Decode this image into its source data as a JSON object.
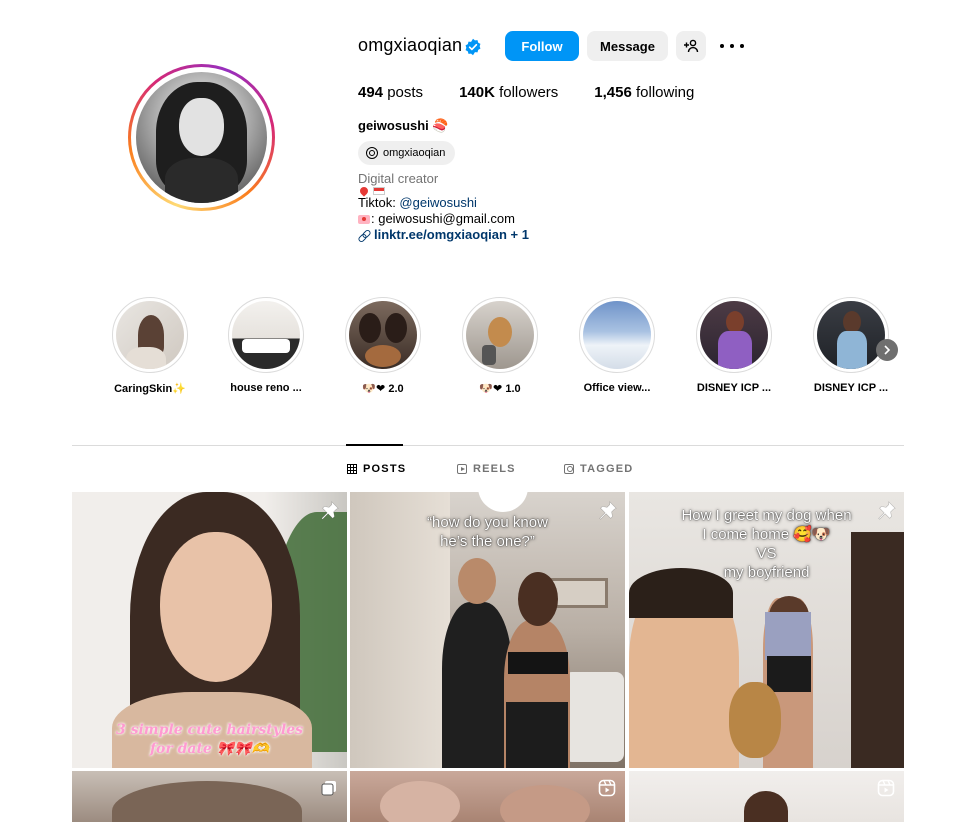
{
  "profile": {
    "username": "omgxiaoqian",
    "verified_icon": "verified-badge-icon",
    "follow_label": "Follow",
    "message_label": "Message",
    "add_user_icon": "add-user-icon",
    "more_icon": "more-options-icon",
    "stats": {
      "posts_count": "494",
      "posts_label": "posts",
      "followers_count": "140K",
      "followers_label": "followers",
      "following_count": "1,456",
      "following_label": "following"
    },
    "display_name": "geiwosushi",
    "display_name_emoji": "🍣",
    "threads_handle": "omgxiaoqian",
    "category": "Digital creator",
    "bio_tiktok_prefix": "Tiktok: ",
    "bio_tiktok_handle": "@geiwosushi",
    "bio_email": ": geiwosushi@gmail.com",
    "bio_link": "linktr.ee/omgxiaoqian + 1"
  },
  "highlights": [
    {
      "label": "CaringSkin✨"
    },
    {
      "label": "house reno ..."
    },
    {
      "label": "🐶❤ 2.0"
    },
    {
      "label": "🐶❤ 1.0"
    },
    {
      "label": "Office view..."
    },
    {
      "label": "DISNEY ICP ..."
    },
    {
      "label": "DISNEY ICP ..."
    }
  ],
  "tabs": {
    "posts": "POSTS",
    "reels": "REELS",
    "tagged": "TAGGED",
    "active": "posts"
  },
  "posts": [
    {
      "caption": "3 simple cute hairstyles\nfor date 🎀🎀🫶",
      "pinned": true
    },
    {
      "caption": "“how do you know\nhe’s the one?”",
      "pinned": true
    },
    {
      "caption": "How I greet my dog when\nI come home 🥰🐶\nVS\nmy boyfriend",
      "pinned": true
    },
    {
      "caption": "",
      "type": "carousel"
    },
    {
      "caption": "",
      "type": "reel"
    },
    {
      "caption": "",
      "type": "reel"
    }
  ],
  "colors": {
    "follow_button": "#0095f6",
    "secondary_button": "#efefef",
    "link": "#00376b",
    "muted": "#737373"
  }
}
